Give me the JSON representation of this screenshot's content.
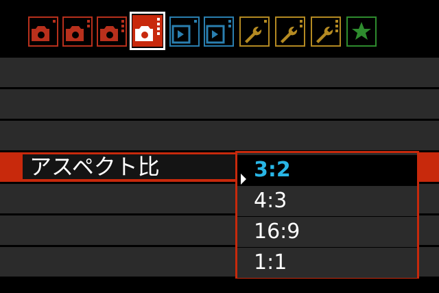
{
  "menu": {
    "tabs": [
      {
        "name": "shooting-tab-1",
        "color": "#b8301c",
        "type": "camera"
      },
      {
        "name": "shooting-tab-2",
        "color": "#b8301c",
        "type": "camera"
      },
      {
        "name": "shooting-tab-3",
        "color": "#b8301c",
        "type": "camera"
      },
      {
        "name": "shooting-tab-4",
        "color": "#c8290c",
        "type": "camera",
        "active": true
      },
      {
        "name": "playback-tab-1",
        "color": "#2a7fb0",
        "type": "playback"
      },
      {
        "name": "playback-tab-2",
        "color": "#2a7fb0",
        "type": "playback"
      },
      {
        "name": "setup-tab-1",
        "color": "#b48a22",
        "type": "wrench"
      },
      {
        "name": "setup-tab-2",
        "color": "#b48a22",
        "type": "wrench"
      },
      {
        "name": "setup-tab-3",
        "color": "#b48a22",
        "type": "wrench"
      },
      {
        "name": "my-menu-tab",
        "color": "#2e8c2e",
        "type": "star"
      }
    ],
    "selected_item": {
      "label": "アスペクト比"
    },
    "options": [
      "3:2",
      "4:3",
      "16:9",
      "1:1"
    ],
    "current_option": "3:2",
    "colors": {
      "selected_row": "#c8290c",
      "current_option_text": "#29b6e6",
      "row_background": "#2b2b2b"
    }
  }
}
